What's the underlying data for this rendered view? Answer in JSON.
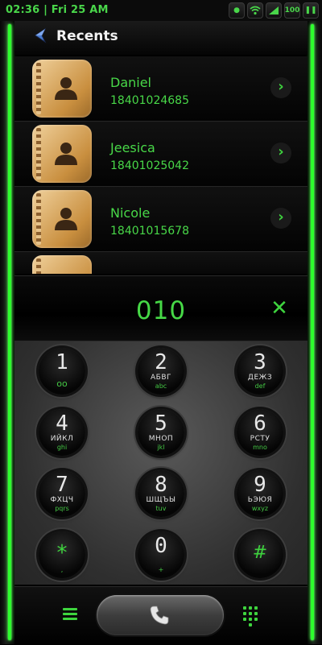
{
  "status_bar": {
    "time": "02:36 | Fri 25 AM",
    "battery": "100"
  },
  "header": {
    "title": "Recents"
  },
  "contacts": [
    {
      "name": "Daniel",
      "number": "18401024685"
    },
    {
      "name": "Jeesica",
      "number": "18401025042"
    },
    {
      "name": "Nicole",
      "number": "18401015678"
    }
  ],
  "dial": {
    "number": "010"
  },
  "keypad": [
    {
      "digit": "1",
      "ru": "",
      "en": "oo"
    },
    {
      "digit": "2",
      "ru": "АБВГ",
      "en": "abc"
    },
    {
      "digit": "3",
      "ru": "ДЕЖЗ",
      "en": "def"
    },
    {
      "digit": "4",
      "ru": "ИЙКЛ",
      "en": "ghi"
    },
    {
      "digit": "5",
      "ru": "МНОП",
      "en": "jkl"
    },
    {
      "digit": "6",
      "ru": "РСТУ",
      "en": "mno"
    },
    {
      "digit": "7",
      "ru": "ФХЦЧ",
      "en": "pqrs"
    },
    {
      "digit": "8",
      "ru": "ШЩЪЫ",
      "en": "tuv"
    },
    {
      "digit": "9",
      "ru": "ЬЭЮЯ",
      "en": "wxyz"
    },
    {
      "digit": "*",
      "ru": "",
      "en": ","
    },
    {
      "digit": "0",
      "ru": "",
      "en": "+"
    },
    {
      "digit": "#",
      "ru": "",
      "en": ""
    }
  ],
  "colors": {
    "accent": "#3ed43e",
    "neon": "#2dff2d"
  }
}
